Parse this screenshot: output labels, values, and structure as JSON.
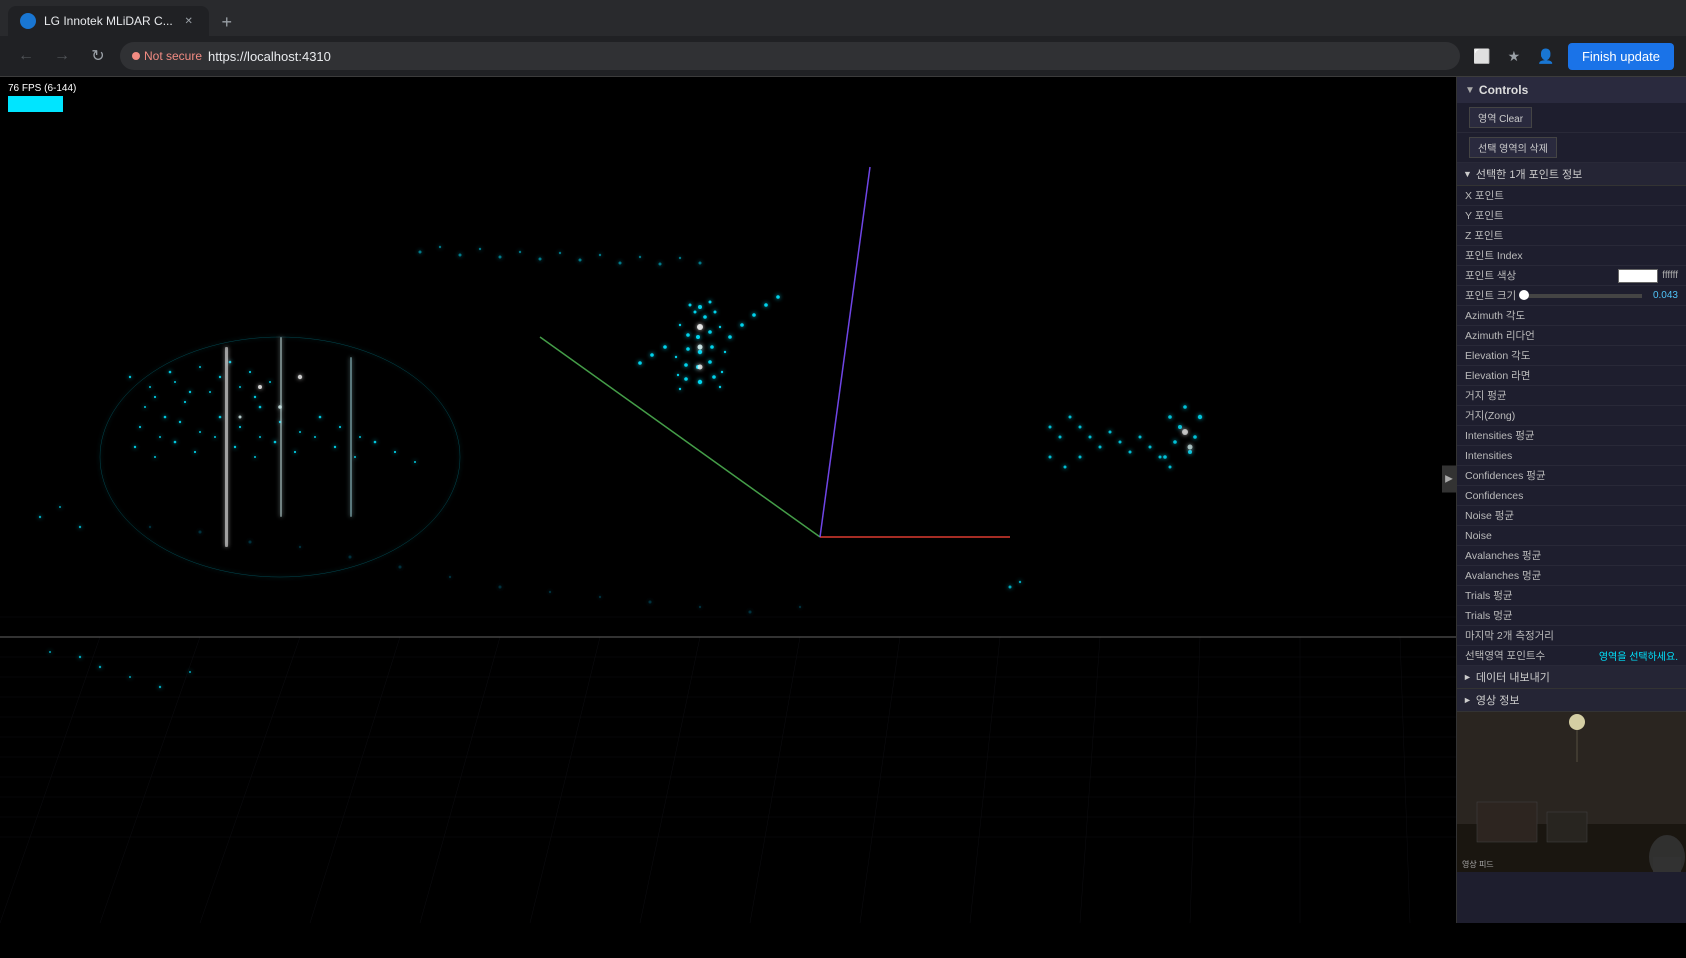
{
  "browser": {
    "title": "LG Innotek MLiDAR C...",
    "tab_label": "LG Innotek MLiDAR C...",
    "url": "https://localhost:4310",
    "not_secure_label": "Not secure",
    "finish_update_label": "Finish update",
    "new_tab_symbol": "+"
  },
  "fps": {
    "label": "76 FPS (6-144)"
  },
  "controls_panel": {
    "title": "Controls",
    "buttons": {
      "clear_label": "영역 Clear",
      "deselect_label": "선택 영역의 삭제"
    },
    "point_info_section": {
      "title": "선택한 1개 포인트 정보",
      "rows": [
        {
          "label": "X 포인트",
          "value": ""
        },
        {
          "label": "Y 포인트",
          "value": ""
        },
        {
          "label": "Z 포인트",
          "value": ""
        },
        {
          "label": "포인트 Index",
          "value": ""
        },
        {
          "label": "포인트 색상",
          "color": "#ffffff",
          "color_hex": "ffffff"
        },
        {
          "label": "포인트 크기",
          "slider_pct": 3,
          "value": "0.043"
        },
        {
          "label": "Azimuth 각도",
          "value": ""
        },
        {
          "label": "Azimuth 리다언",
          "value": ""
        },
        {
          "label": "Elevation 각도",
          "value": ""
        },
        {
          "label": "Elevation 라면",
          "value": ""
        },
        {
          "label": "거지 펑균",
          "value": ""
        },
        {
          "label": "거지(Zong)",
          "value": ""
        },
        {
          "label": "Intensities 펑균",
          "value": ""
        },
        {
          "label": "Intensities",
          "value": ""
        },
        {
          "label": "Confidences 펑균",
          "value": ""
        },
        {
          "label": "Confidences",
          "value": ""
        },
        {
          "label": "Noise 펑균",
          "value": ""
        },
        {
          "label": "Noise",
          "value": ""
        },
        {
          "label": "Avalanches 펑균",
          "value": ""
        },
        {
          "label": "Avalanches 멍균",
          "value": ""
        },
        {
          "label": "Trials 펑균",
          "value": ""
        },
        {
          "label": "Trials 멍균",
          "value": ""
        },
        {
          "label": "마지막 2개 측정거리",
          "value": ""
        },
        {
          "label": "선택영역 포인트수",
          "value": "영역을 선택하세요."
        }
      ]
    },
    "export_section": {
      "title": "데이터 내보내기"
    },
    "video_section": {
      "title": "영상 정보"
    }
  }
}
